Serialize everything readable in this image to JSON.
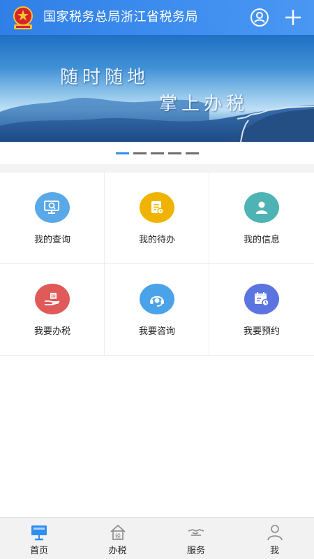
{
  "header": {
    "title": "国家税务总局浙江省税务局",
    "user_icon": "user-circle-icon",
    "add_icon": "plus-icon"
  },
  "banner": {
    "line1": "随时随地",
    "line2": "掌上办税"
  },
  "pager": {
    "total": 5,
    "active_index": 0
  },
  "grid": {
    "items": [
      {
        "label": "我的查询",
        "icon": "search-monitor-icon",
        "color": "#5aa8e8"
      },
      {
        "label": "我的待办",
        "icon": "document-clock-icon",
        "color": "#f0b400"
      },
      {
        "label": "我的信息",
        "icon": "user-icon",
        "color": "#4fb3b3"
      },
      {
        "label": "我要办税",
        "icon": "hand-tax-icon",
        "color": "#e05a5a"
      },
      {
        "label": "我要咨询",
        "icon": "headset-icon",
        "color": "#4aa3e8"
      },
      {
        "label": "我要预约",
        "icon": "calendar-clock-icon",
        "color": "#5b74e0"
      }
    ]
  },
  "bottom_nav": {
    "items": [
      {
        "label": "首页",
        "icon": "home-monitor-icon",
        "active": true
      },
      {
        "label": "办税",
        "icon": "tax-house-icon",
        "active": false
      },
      {
        "label": "服务",
        "icon": "handshake-icon",
        "active": false
      },
      {
        "label": "我",
        "icon": "person-icon",
        "active": false
      }
    ]
  },
  "colors": {
    "header_blue": "#3a88ec",
    "accent_blue": "#2f8ff0"
  }
}
